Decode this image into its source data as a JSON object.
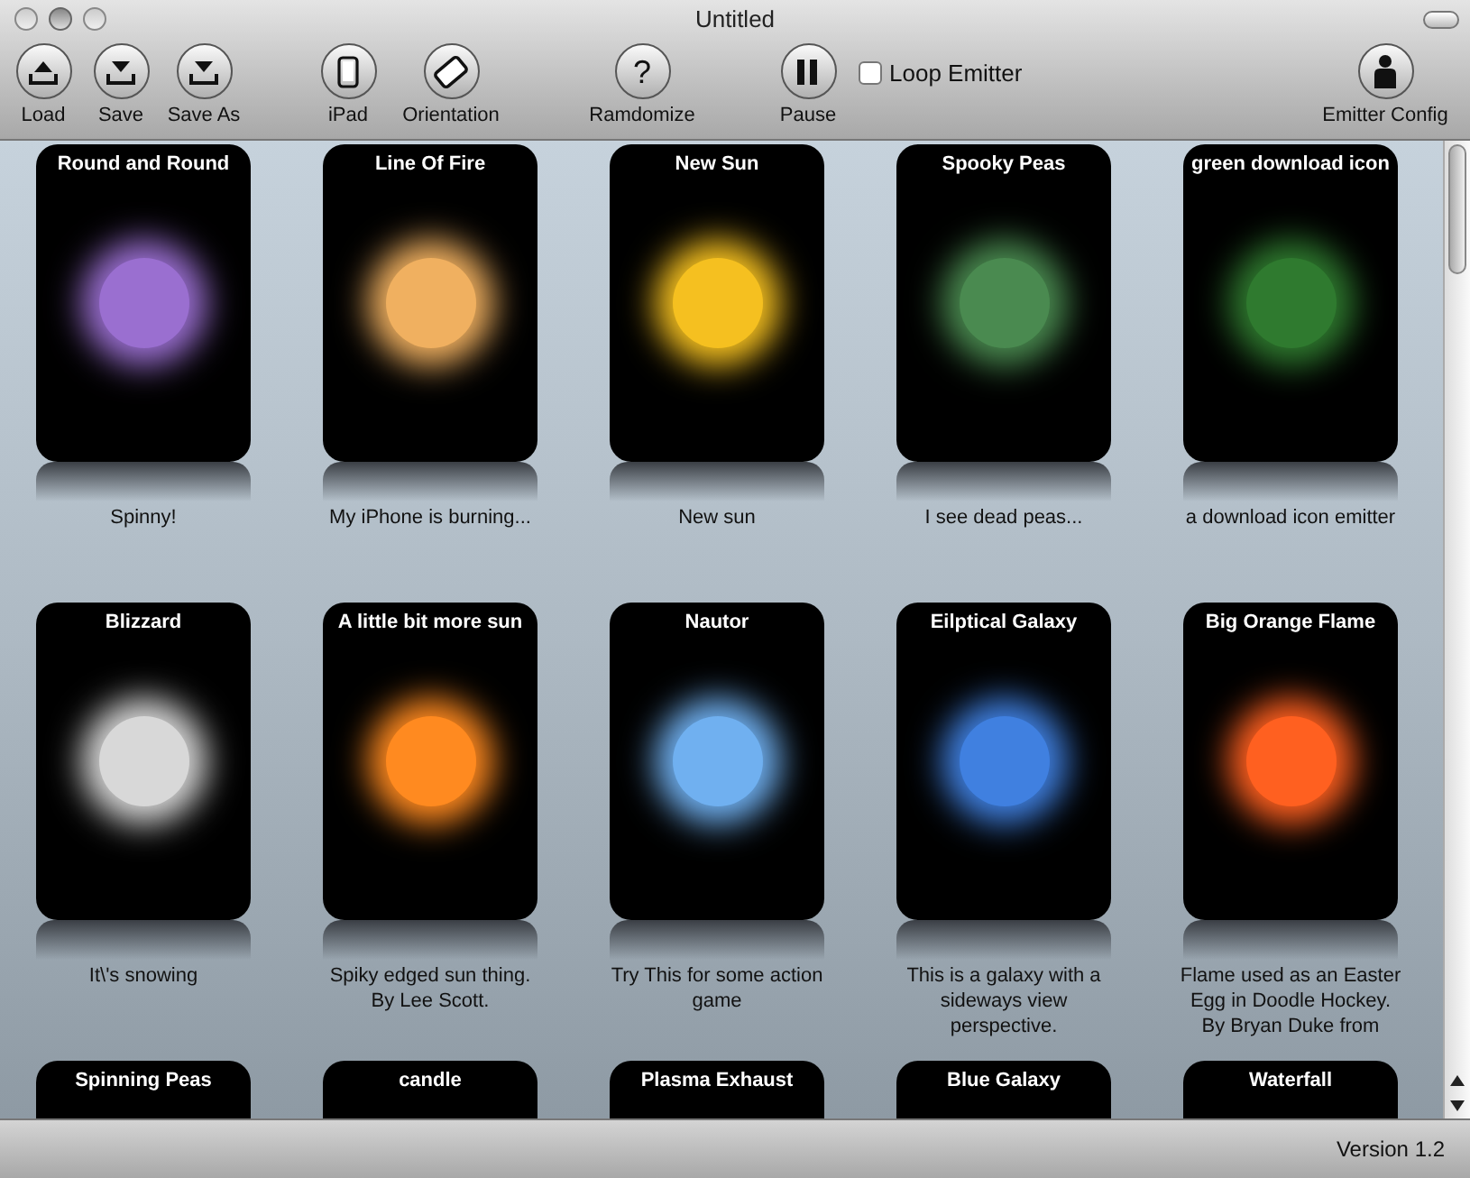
{
  "window": {
    "title": "Untitled"
  },
  "toolbar": [
    {
      "label": "Load",
      "kind": "load"
    },
    {
      "label": "Save",
      "kind": "save"
    },
    {
      "label": "Save As",
      "kind": "save"
    },
    {
      "label": "iPad",
      "kind": "ipad"
    },
    {
      "label": "Orientation",
      "kind": "rotate"
    },
    {
      "label": "Ramdomize",
      "kind": "random",
      "icon": "?"
    },
    {
      "label": "Pause",
      "kind": "pause"
    }
  ],
  "loop_emitter": {
    "label": "Loop Emitter",
    "checked": false
  },
  "emitter_config": {
    "label": "Emitter Config"
  },
  "emitters": [
    {
      "title": "Round and Round",
      "description": "Spinny!",
      "color": "#9a6fd0"
    },
    {
      "title": "Line Of Fire",
      "description": "My iPhone is burning...",
      "color": "#f0b060"
    },
    {
      "title": "New Sun",
      "description": "New sun",
      "color": "#f5c020"
    },
    {
      "title": "Spooky Peas",
      "description": "I see dead peas...",
      "color": "#4a8a50"
    },
    {
      "title": "green download icon",
      "description": "a download icon emitter",
      "color": "#2f7a2f"
    },
    {
      "title": "Blizzard",
      "description": "It\\'s snowing",
      "color": "#d8d8d8"
    },
    {
      "title": "A little bit more sun",
      "description": "Spiky edged sun thing. By Lee Scott.",
      "color": "#ff8a20"
    },
    {
      "title": "Nautor",
      "description": "Try This for some action game",
      "color": "#70b0f0"
    },
    {
      "title": "Eilptical Galaxy",
      "description": "This is a galaxy with a sideways view perspective.",
      "color": "#4080e0"
    },
    {
      "title": "Big Orange Flame",
      "description": "Flame used as an Easter Egg in Doodle Hockey.  By Bryan Duke from",
      "color": "#ff6020"
    },
    {
      "title": "Spinning Peas"
    },
    {
      "title": "candle"
    },
    {
      "title": "Plasma Exhaust"
    },
    {
      "title": "Blue Galaxy"
    },
    {
      "title": "Waterfall"
    }
  ],
  "status_bar": {
    "version": "Version 1.2"
  }
}
